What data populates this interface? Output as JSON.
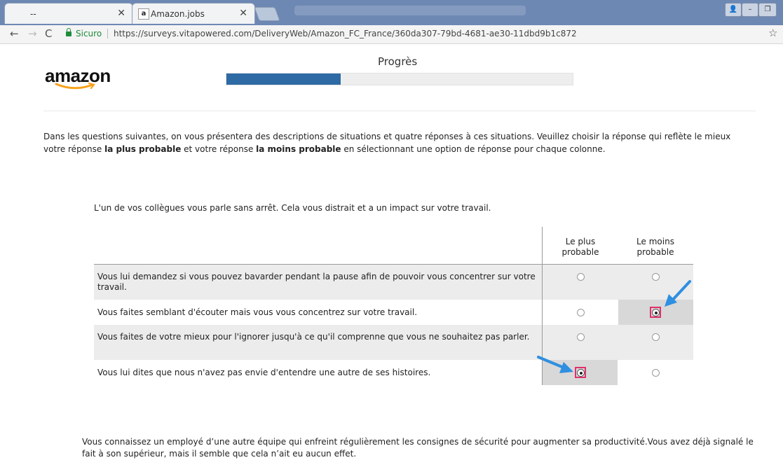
{
  "browser": {
    "tabs": [
      {
        "label": "--",
        "active": false
      },
      {
        "label": "Amazon.jobs",
        "active": true
      }
    ],
    "secure_label": "Sicuro",
    "url": "https://surveys.vitapowered.com/DeliveryWeb/Amazon_FC_France/360da307-79bd-4681-ae30-11dbd9b1c872"
  },
  "page": {
    "logo_text": "amazon",
    "progress": {
      "label": "Progrès",
      "fraction": 0.33
    },
    "intro": {
      "part1": "Dans les questions suivantes, on vous présentera des descriptions de situations et quatre réponses à ces situations. Veuillez choisir la réponse qui reflète le mieux votre réponse ",
      "bold1": "la plus probable",
      "part2": " et votre réponse ",
      "bold2": "la moins probable",
      "part3": " en sélectionnant une option de réponse pour chaque colonne."
    },
    "question1": {
      "text": "L'un de vos collègues vous parle sans arrêt. Cela vous distrait et a un impact sur votre travail.",
      "col_most": "Le plus probable",
      "col_least": "Le moins probable",
      "options": [
        {
          "text": "Vous lui demandez si vous pouvez bavarder pendant la pause afin de pouvoir vous concentrer sur votre travail.",
          "most": false,
          "least": false
        },
        {
          "text": "Vous faites semblant d'écouter mais vous vous concentrez sur votre travail.",
          "most": false,
          "least": true
        },
        {
          "text": "Vous faites de votre mieux pour l'ignorer jusqu'à ce qu'il comprenne que vous ne souhaitez pas parler.",
          "most": false,
          "least": false
        },
        {
          "text": "Vous lui dites que nous n'avez pas envie d'entendre une autre de ses histoires.",
          "most": true,
          "least": false
        }
      ]
    },
    "question2": {
      "text": "Vous connaissez un employé d’une autre équipe qui enfreint régulièrement les consignes de sécurité pour augmenter sa productivité.Vous avez déjà signalé le fait à son supérieur, mais il semble que cela n’ait eu aucun effet."
    },
    "colors": {
      "progress_fill": "#2e6aa4",
      "highlight": "#e0306e",
      "arrow": "#2f8fe0",
      "amazon_smile": "#f7a21b"
    }
  }
}
